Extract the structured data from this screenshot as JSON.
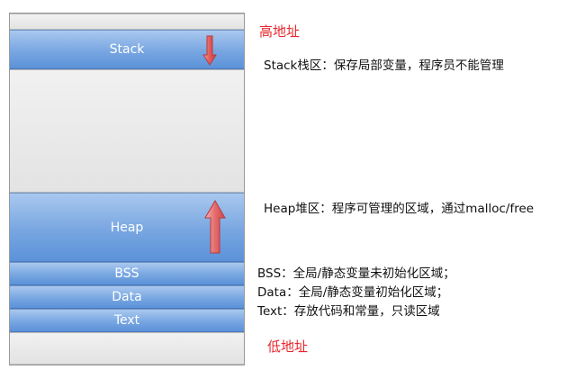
{
  "colors": {
    "address_label": "#e8262c",
    "segment_fill": "#78a6e1",
    "arrow_fill": "#e56b6b"
  },
  "labels": {
    "high_address": "高地址",
    "low_address": "低地址"
  },
  "segments": {
    "stack": "Stack",
    "heap": "Heap",
    "bss": "BSS",
    "data": "Data",
    "text": "Text"
  },
  "notes": {
    "stack": "Stack栈区：保存局部变量，程序员不能管理",
    "heap": "Heap堆区：程序可管理的区域，通过malloc/free",
    "bss": "BSS：全局/静态变量未初始化区域；",
    "data": "Data：全局/静态变量初始化区域；",
    "text": "Text：存放代码和常量，只读区域"
  }
}
